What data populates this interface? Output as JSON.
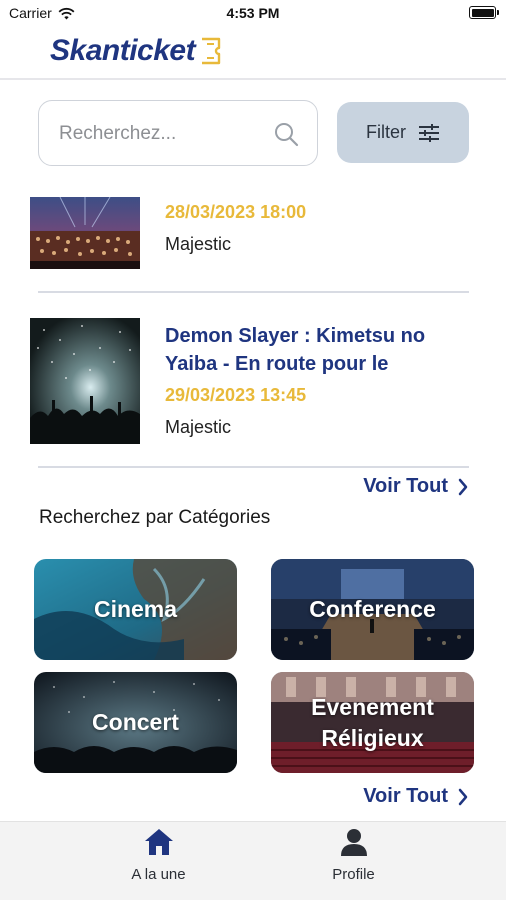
{
  "status_bar": {
    "carrier": "Carrier",
    "time": "4:53 PM"
  },
  "header": {
    "logo_text": "Skanticket"
  },
  "search": {
    "placeholder": "Recherchez...",
    "filter_label": "Filter"
  },
  "events": [
    {
      "date": "28/03/2023 18:00",
      "venue": "Majestic",
      "title": ""
    },
    {
      "title": "Demon Slayer : Kimetsu no Yaiba - En route pour le",
      "date": "29/03/2023 13:45",
      "venue": "Majestic"
    }
  ],
  "see_all_label": "Voir Tout",
  "categories_section": {
    "title": "Recherchez par Catégories",
    "items": [
      {
        "label": "Cinema"
      },
      {
        "label": "Conference"
      },
      {
        "label": "Concert"
      },
      {
        "label": "Evenement Réligieux"
      }
    ]
  },
  "tab_bar": {
    "home_label": "A la une",
    "profile_label": "Profile"
  },
  "colors": {
    "brand": "#1f3580",
    "accent": "#e8b93a",
    "filter_bg": "#c8d3df"
  }
}
